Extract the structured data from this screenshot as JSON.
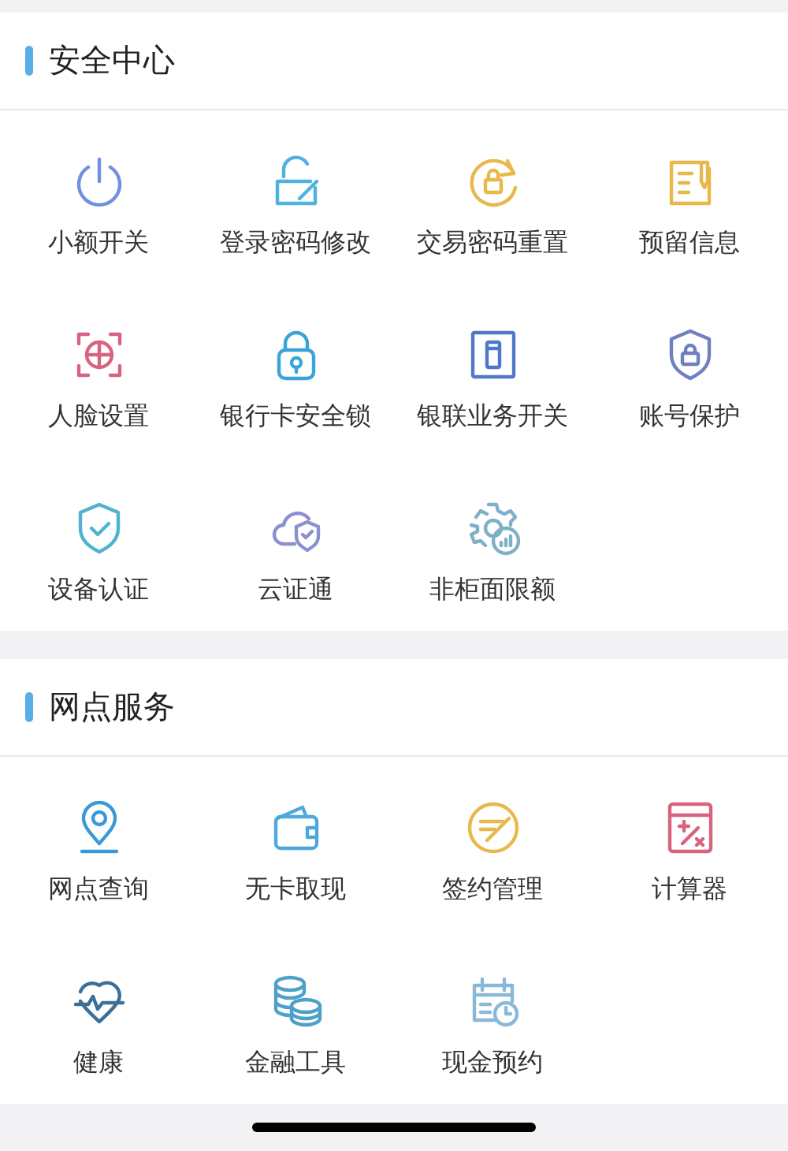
{
  "sections": [
    {
      "title": "安全中心",
      "items": [
        {
          "label": "小额开关",
          "kind": "power"
        },
        {
          "label": "登录密码修改",
          "kind": "lock-edit"
        },
        {
          "label": "交易密码重置",
          "kind": "lock-refresh"
        },
        {
          "label": "预留信息",
          "kind": "document-pen"
        },
        {
          "label": "人脸设置",
          "kind": "face-scan"
        },
        {
          "label": "银行卡安全锁",
          "kind": "padlock"
        },
        {
          "label": "银联业务开关",
          "kind": "switch"
        },
        {
          "label": "账号保护",
          "kind": "shield-lock"
        },
        {
          "label": "设备认证",
          "kind": "shield-check"
        },
        {
          "label": "云证通",
          "kind": "cloud-shield"
        },
        {
          "label": "非柜面限额",
          "kind": "gear-chart"
        }
      ]
    },
    {
      "title": "网点服务",
      "items": [
        {
          "label": "网点查询",
          "kind": "location-pin"
        },
        {
          "label": "无卡取现",
          "kind": "wallet"
        },
        {
          "label": "签约管理",
          "kind": "circle-pen"
        },
        {
          "label": "计算器",
          "kind": "calculator"
        },
        {
          "label": "健康",
          "kind": "heart-pulse"
        },
        {
          "label": "金融工具",
          "kind": "coins"
        },
        {
          "label": "现金预约",
          "kind": "calendar-clock"
        }
      ]
    }
  ]
}
